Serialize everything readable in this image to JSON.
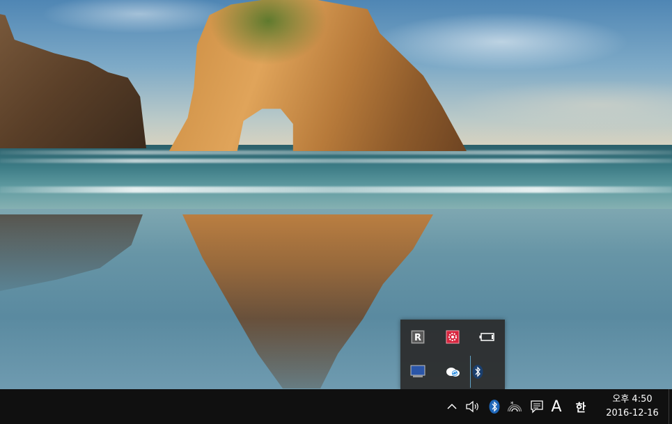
{
  "desktop": {
    "wallpaper": "Windows 10 default beach with sea-arch rock"
  },
  "tray_overflow": {
    "icons": [
      {
        "name": "r-app-icon",
        "glyph": "R"
      },
      {
        "name": "settings-gear-app-icon",
        "color": "#d8263f"
      },
      {
        "name": "battery-icon"
      },
      {
        "name": "display-monitor-icon"
      },
      {
        "name": "cloud-sync-icon"
      },
      {
        "name": "bluetooth-icon"
      }
    ]
  },
  "taskbar": {
    "chevron_label": "^",
    "ime_mode": "A",
    "ime_language": "한",
    "clock": {
      "time": "오후 4:50",
      "date": "2016-12-16"
    },
    "bluetooth_badge_color": "#1e66b8"
  }
}
